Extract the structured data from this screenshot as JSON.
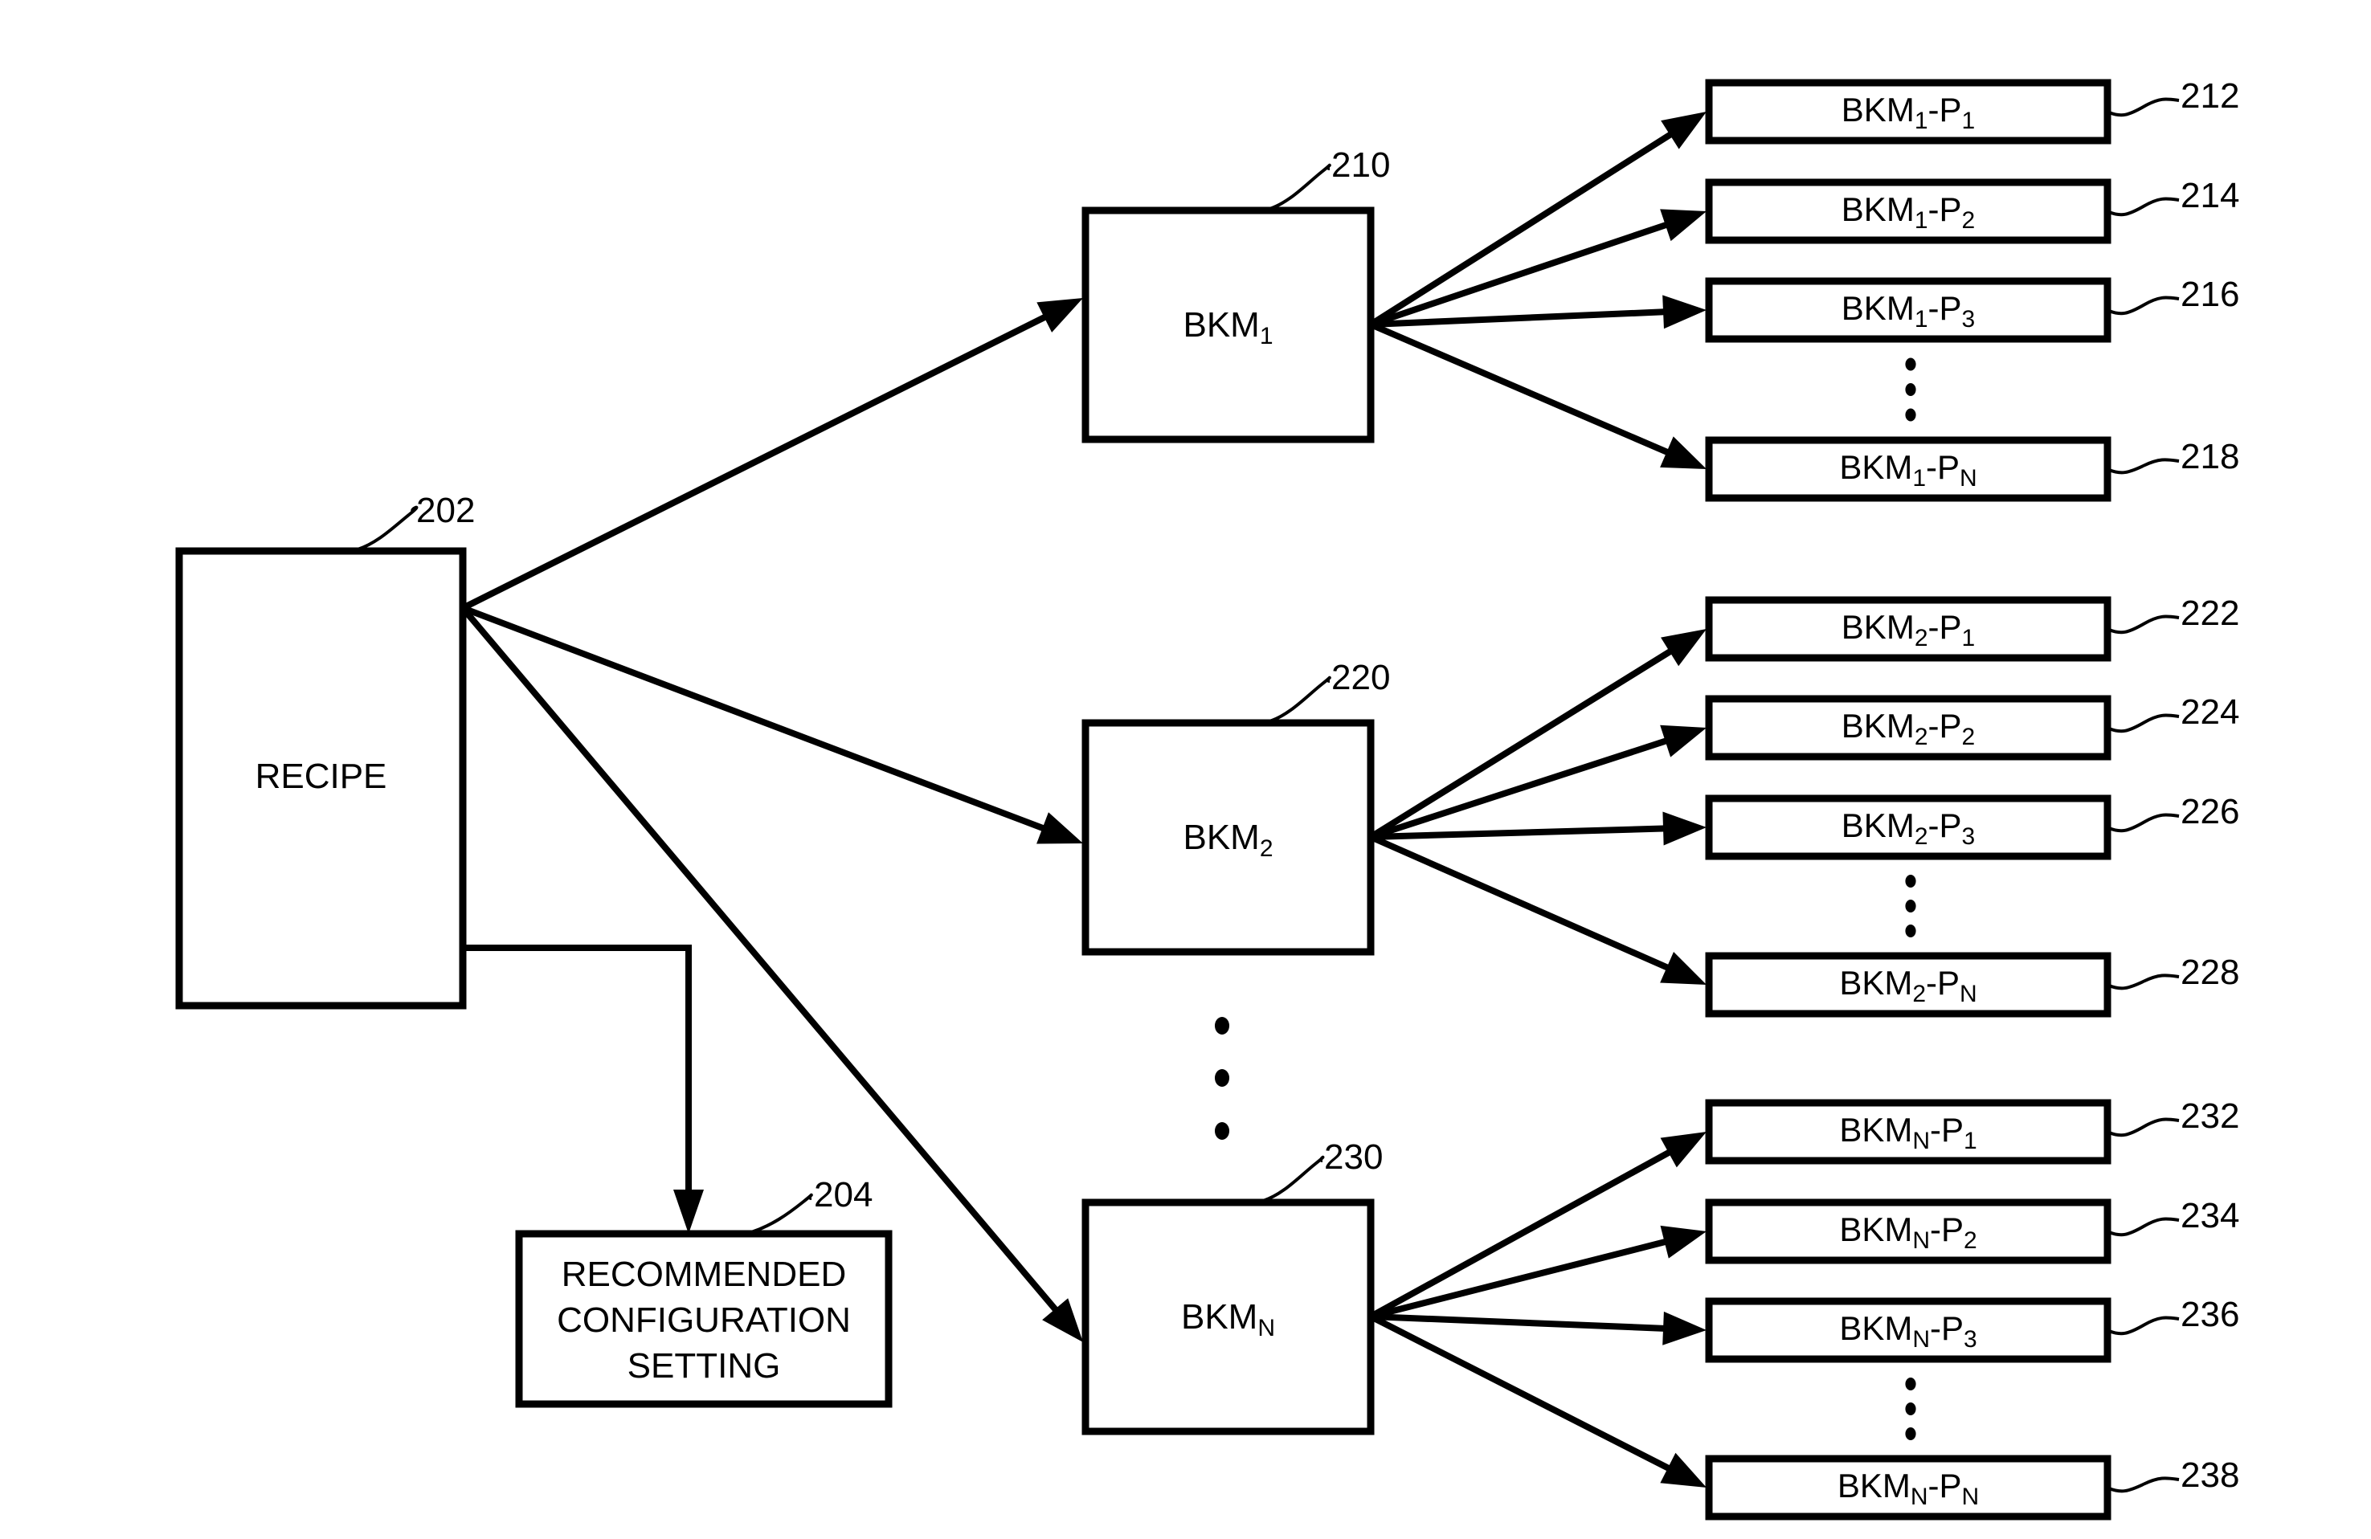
{
  "figure": {
    "recipe": {
      "label": "RECIPE",
      "ref": "202"
    },
    "recommended": {
      "lines": [
        "RECOMMENDED",
        "CONFIGURATION",
        "SETTING"
      ],
      "ref": "204"
    },
    "bkm_groups": [
      {
        "base": "BKM",
        "sub": "1",
        "ref": "210",
        "children": [
          {
            "base": "BKM",
            "sub": "1",
            "p": "P",
            "psub": "1",
            "ref": "212"
          },
          {
            "base": "BKM",
            "sub": "1",
            "p": "P",
            "psub": "2",
            "ref": "214"
          },
          {
            "base": "BKM",
            "sub": "1",
            "p": "P",
            "psub": "3",
            "ref": "216"
          },
          {
            "base": "BKM",
            "sub": "1",
            "p": "P",
            "psub": "N",
            "ref": "218"
          }
        ]
      },
      {
        "base": "BKM",
        "sub": "2",
        "ref": "220",
        "children": [
          {
            "base": "BKM",
            "sub": "2",
            "p": "P",
            "psub": "1",
            "ref": "222"
          },
          {
            "base": "BKM",
            "sub": "2",
            "p": "P",
            "psub": "2",
            "ref": "224"
          },
          {
            "base": "BKM",
            "sub": "2",
            "p": "P",
            "psub": "3",
            "ref": "226"
          },
          {
            "base": "BKM",
            "sub": "2",
            "p": "P",
            "psub": "N",
            "ref": "228"
          }
        ]
      },
      {
        "base": "BKM",
        "sub": "N",
        "ref": "230",
        "children": [
          {
            "base": "BKM",
            "sub": "N",
            "p": "P",
            "psub": "1",
            "ref": "232"
          },
          {
            "base": "BKM",
            "sub": "N",
            "p": "P",
            "psub": "2",
            "ref": "234"
          },
          {
            "base": "BKM",
            "sub": "N",
            "p": "P",
            "psub": "3",
            "ref": "236"
          },
          {
            "base": "BKM",
            "sub": "N",
            "p": "P",
            "psub": "N",
            "ref": "238"
          }
        ]
      }
    ],
    "ellipsis_icon": "vertical-ellipsis",
    "colors": {
      "stroke": "#000000",
      "background": "#ffffff"
    }
  }
}
